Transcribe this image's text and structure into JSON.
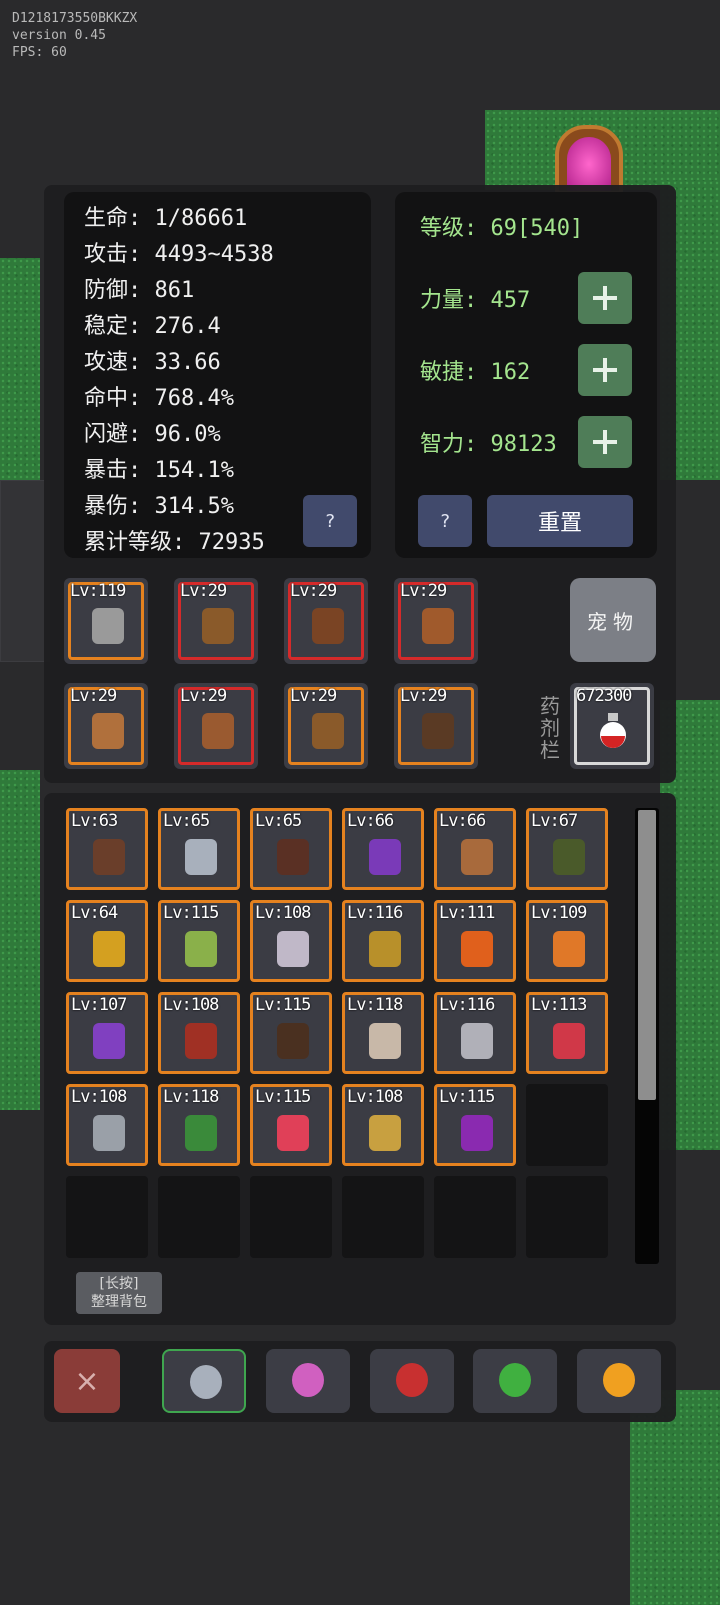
{
  "debug": {
    "device_id": "D1218173550BKKZX",
    "version": "version 0.45",
    "fps": "FPS: 60"
  },
  "stats": {
    "hp": "生命: 1/86661",
    "attack": "攻击: 4493~4538",
    "defense": "防御: 861",
    "stability": "稳定: 276.4",
    "attack_speed": "攻速: 33.66",
    "accuracy": "命中: 768.4%",
    "evasion": "闪避: 96.0%",
    "crit": "暴击: 154.1%",
    "crit_damage": "暴伤: 314.5%",
    "total_level": "累计等级: 72935",
    "help_label": "?"
  },
  "attributes": {
    "level": "等级: 69[540]",
    "strength": "力量: 457",
    "agility": "敏捷: 162",
    "intelligence": "智力: 98123",
    "help_label": "?",
    "reset_label": "重置"
  },
  "equipment": [
    {
      "level": "Lv:119",
      "rarity": "orange",
      "icon": "double-axe-icon",
      "color": "#9a9a9a"
    },
    {
      "level": "Lv:29",
      "rarity": "red",
      "icon": "round-shield-icon",
      "color": "#8a5a2a"
    },
    {
      "level": "Lv:29",
      "rarity": "red",
      "icon": "leather-cap-icon",
      "color": "#7a4424"
    },
    {
      "level": "Lv:29",
      "rarity": "red",
      "icon": "leather-armor-icon",
      "color": "#a05a2c"
    },
    {
      "level": "Lv:29",
      "rarity": "orange",
      "icon": "leather-gloves-icon",
      "color": "#b0703c"
    },
    {
      "level": "Lv:29",
      "rarity": "red",
      "icon": "leather-boots-icon",
      "color": "#9a5a30"
    },
    {
      "level": "Lv:29",
      "rarity": "orange",
      "icon": "bronze-ring-icon",
      "color": "#8a5a2a"
    },
    {
      "level": "Lv:29",
      "rarity": "orange",
      "icon": "necklace-icon",
      "color": "#5a3a24"
    }
  ],
  "pet_label": "宠物",
  "potion": {
    "label": "药剂栏",
    "count": "672300",
    "icon": "red-potion-icon"
  },
  "inventory": [
    {
      "level": "Lv:63",
      "icon": "leather-shield-icon",
      "color": "#6a3e2a"
    },
    {
      "level": "Lv:65",
      "icon": "short-sword-icon",
      "color": "#a8b0bc"
    },
    {
      "level": "Lv:65",
      "icon": "dark-helmet-icon",
      "color": "#5a3024"
    },
    {
      "level": "Lv:66",
      "icon": "purple-boots-icon",
      "color": "#7a3ab8"
    },
    {
      "level": "Lv:66",
      "icon": "brown-gloves-icon",
      "color": "#a86a3c"
    },
    {
      "level": "Lv:67",
      "icon": "green-amulet-icon",
      "color": "#4a5a2a"
    },
    {
      "level": "Lv:64",
      "icon": "gold-ring-icon",
      "color": "#d4a020"
    },
    {
      "level": "Lv:115",
      "icon": "green-boots-icon",
      "color": "#8ab04a"
    },
    {
      "level": "Lv:108",
      "icon": "silver-ring-icon",
      "color": "#c0b8c8"
    },
    {
      "level": "Lv:116",
      "icon": "golden-helmet-icon",
      "color": "#b8902a"
    },
    {
      "level": "Lv:111",
      "icon": "fire-ring-icon",
      "color": "#e0601c"
    },
    {
      "level": "Lv:109",
      "icon": "orange-armor-icon",
      "color": "#e07828"
    },
    {
      "level": "Lv:107",
      "icon": "violet-boots-icon",
      "color": "#8040c0"
    },
    {
      "level": "Lv:108",
      "icon": "red-gauntlet-icon",
      "color": "#a03024"
    },
    {
      "level": "Lv:115",
      "icon": "iron-shield-icon",
      "color": "#4a3020"
    },
    {
      "level": "Lv:118",
      "icon": "bone-armor-icon",
      "color": "#c8b8a8"
    },
    {
      "level": "Lv:116",
      "icon": "dagger-icon",
      "color": "#b0b0b8"
    },
    {
      "level": "Lv:113",
      "icon": "crimson-gloves-icon",
      "color": "#d03848"
    },
    {
      "level": "Lv:108",
      "icon": "knight-helmet-icon",
      "color": "#9aa0a8"
    },
    {
      "level": "Lv:118",
      "icon": "green-armor-icon",
      "color": "#3a8a3a"
    },
    {
      "level": "Lv:115",
      "icon": "red-boots-icon",
      "color": "#e04058"
    },
    {
      "level": "Lv:108",
      "icon": "thorn-ring-icon",
      "color": "#c8a040"
    },
    {
      "level": "Lv:115",
      "icon": "amethyst-amulet-icon",
      "color": "#8a2ab0"
    }
  ],
  "sort_button": {
    "line1": "[长按]",
    "line2": "整理背包"
  },
  "tabs": [
    {
      "name": "equipment",
      "icon": "sword-icon",
      "color": "#a8b0bc",
      "active": true
    },
    {
      "name": "gems",
      "icon": "gem-icon",
      "color": "#d060c0",
      "active": false
    },
    {
      "name": "potions",
      "icon": "potion-icon",
      "color": "#c83030",
      "active": false
    },
    {
      "name": "herbs",
      "icon": "leaf-icon",
      "color": "#40b040",
      "active": false
    },
    {
      "name": "eggs",
      "icon": "egg-icon",
      "color": "#f0a020",
      "active": false
    }
  ],
  "close_label": "×",
  "colors": {
    "border_orange": "#e5821f",
    "border_red": "#d52a2a",
    "attr_green": "#a4e58e",
    "button_blue": "#414a6c",
    "plus_green": "#4f7d58"
  }
}
